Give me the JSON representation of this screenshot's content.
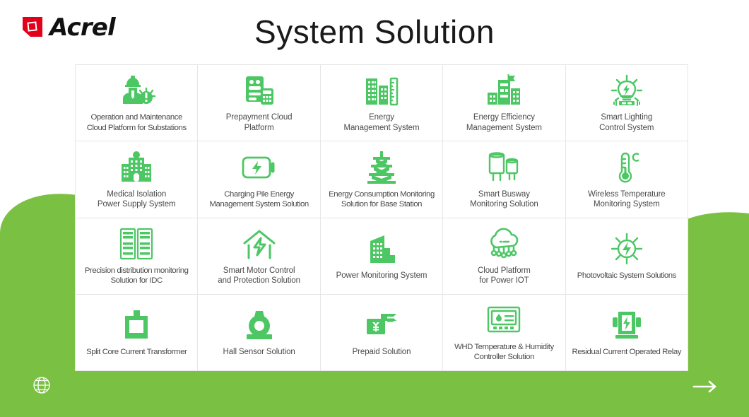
{
  "brand": {
    "name": "Acrel",
    "logo_icon": "acrel-square-logo",
    "logo_red": "#E3001B",
    "logo_dark": "#111111"
  },
  "header": {
    "title": "System Solution"
  },
  "theme": {
    "green": "#7AC143",
    "icon_green": "#4CC764",
    "icon_green_alt": "#46BE5A",
    "border": "#E6E6E6",
    "label_color": "#4A4A4A",
    "background": "#FFFFFF"
  },
  "footer": {
    "globe_icon": "globe-icon",
    "next_icon": "arrow-right-icon"
  },
  "grid": {
    "columns": 5,
    "rows": 4,
    "items": [
      {
        "id": "operation-maintenance-cloud-platform",
        "label": "Operation and Maintenance\nCloud Platform for Substations",
        "icon": "worker-hardhat-alert-icon",
        "wide": true
      },
      {
        "id": "prepayment-cloud-platform",
        "label": "Prepayment Cloud\nPlatform",
        "icon": "meter-calculator-icon",
        "wide": false
      },
      {
        "id": "energy-management-system",
        "label": "Energy\nManagement System",
        "icon": "buildings-ruler-icon",
        "wide": false
      },
      {
        "id": "energy-efficiency-management-system",
        "label": "Energy Efficiency\nManagement System",
        "icon": "city-flag-icon",
        "wide": false
      },
      {
        "id": "smart-lighting-control-system",
        "label": "Smart Lighting\nControl System",
        "icon": "bulb-bolt-icon",
        "wide": false
      },
      {
        "id": "medical-isolation-power-supply-system",
        "label": "Medical Isolation\nPower Supply System",
        "icon": "hospital-icon",
        "wide": false
      },
      {
        "id": "charging-pile-energy-management",
        "label": "Charging Pile Energy\nManagement System Solution",
        "icon": "battery-bolt-icon",
        "wide": true
      },
      {
        "id": "energy-consumption-base-station",
        "label": "Energy Consumption Monitoring\nSolution for Base Station",
        "icon": "telecom-tower-icon",
        "wide": true
      },
      {
        "id": "smart-busway-monitoring-solution",
        "label": "Smart Busway\nMonitoring Solution",
        "icon": "busway-capacitor-icon",
        "wide": false
      },
      {
        "id": "wireless-temperature-monitoring-system",
        "label": "Wireless Temperature\nMonitoring System",
        "icon": "thermometer-celsius-icon",
        "wide": false
      },
      {
        "id": "precision-distribution-monitoring-idc",
        "label": "Precision distribution monitoring\nSolution for IDC",
        "icon": "server-rack-icon",
        "wide": true
      },
      {
        "id": "smart-motor-control-protection",
        "label": "Smart Motor Control\nand Protection Solution",
        "icon": "house-bolt-icon",
        "wide": false
      },
      {
        "id": "power-monitoring-system",
        "label": "Power Monitoring System",
        "icon": "building-solid-icon",
        "wide": false
      },
      {
        "id": "cloud-platform-power-iot",
        "label": "Cloud Platform\nfor Power IOT",
        "icon": "cloud-iot-icon",
        "wide": false
      },
      {
        "id": "photovoltaic-system-solutions",
        "label": "Photovoltaic System Solutions",
        "icon": "sun-bolt-icon",
        "wide": true
      },
      {
        "id": "split-core-current-transformer",
        "label": "Split Core Current Transformer",
        "icon": "split-core-ct-icon",
        "wide": true
      },
      {
        "id": "hall-sensor-solution",
        "label": "Hall Sensor Solution",
        "icon": "hall-sensor-icon",
        "wide": false
      },
      {
        "id": "prepaid-solution",
        "label": "Prepaid Solution",
        "icon": "yen-card-icon",
        "wide": false
      },
      {
        "id": "whd-temperature-humidity-controller",
        "label": "WHD Temperature & Humidity\nController Solution",
        "icon": "humidity-controller-icon",
        "wide": true
      },
      {
        "id": "residual-current-operated-relay",
        "label": "Residual Current Operated Relay",
        "icon": "relay-bolt-icon",
        "wide": true
      }
    ]
  }
}
